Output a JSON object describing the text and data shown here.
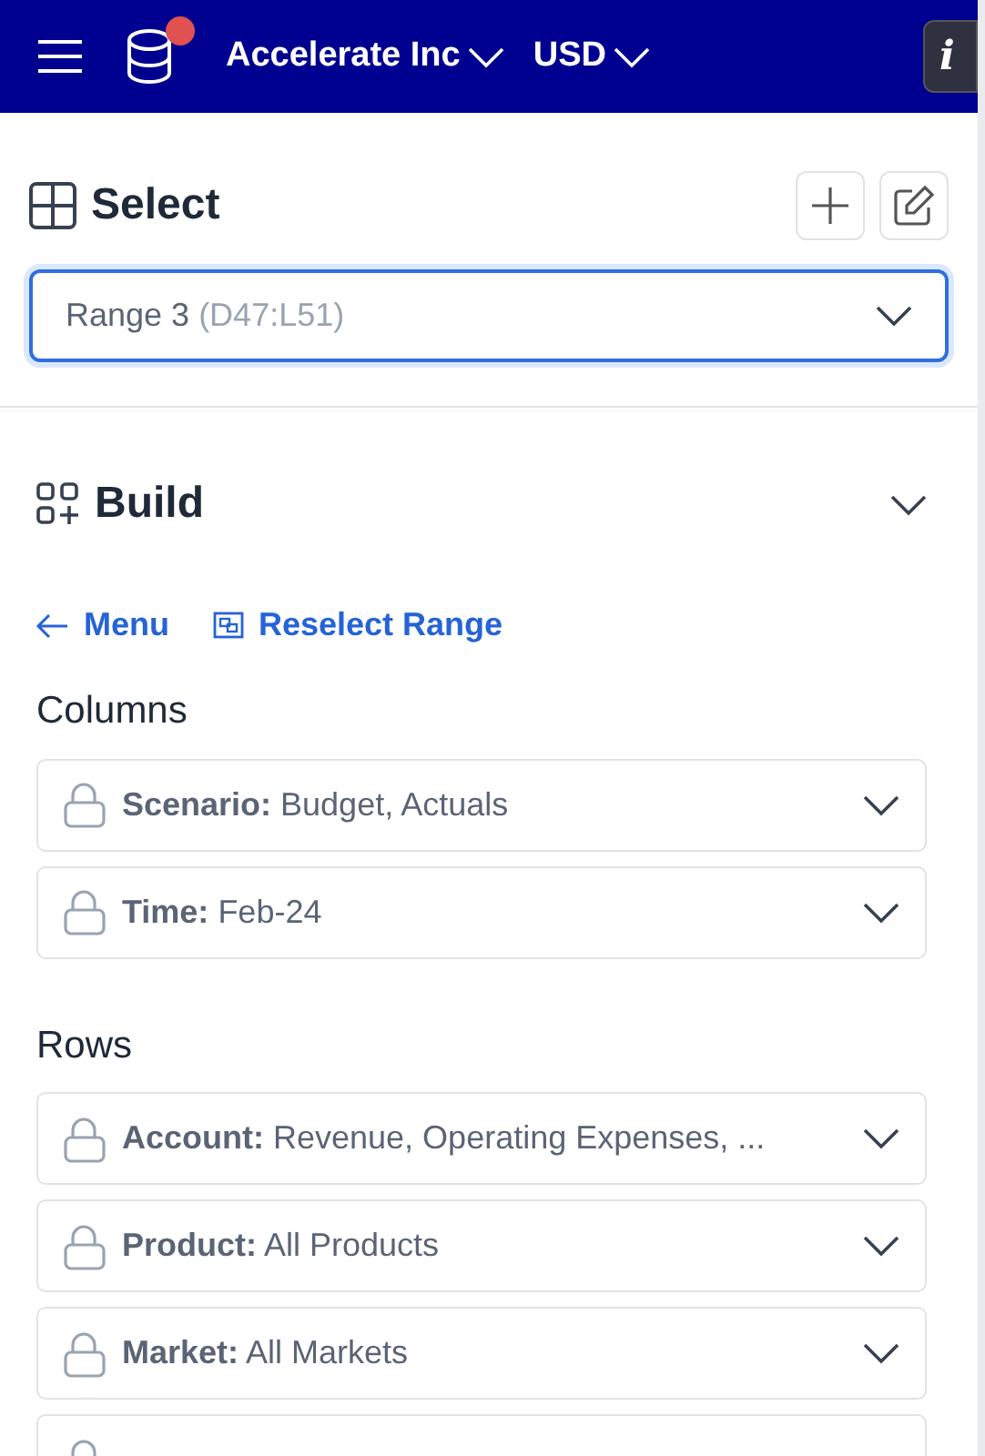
{
  "header": {
    "notification": true,
    "entity": "Accelerate Inc",
    "currency": "USD",
    "info_button": "i"
  },
  "select": {
    "title": "Select",
    "dropdown": {
      "value": "Range 3",
      "detail": "(D47:L51)",
      "focused": true
    }
  },
  "build": {
    "title": "Build",
    "expanded": true,
    "links": [
      {
        "kind": "back",
        "label": "Menu"
      },
      {
        "kind": "reselect",
        "label": "Reselect Range"
      }
    ],
    "sections": [
      {
        "title": "Columns",
        "filters": [
          {
            "label": "Scenario:",
            "value": "Budget, Actuals",
            "locked": true
          },
          {
            "label": "Time:",
            "value": "Feb-24",
            "locked": true
          }
        ]
      },
      {
        "title": "Rows",
        "filters": [
          {
            "label": "Account:",
            "value": "Revenue, Operating Expenses, ...",
            "locked": true
          },
          {
            "label": "Product:",
            "value": "All Products",
            "locked": true
          },
          {
            "label": "Market:",
            "value": "All Markets",
            "locked": true
          },
          {
            "locked": true
          }
        ]
      }
    ]
  }
}
